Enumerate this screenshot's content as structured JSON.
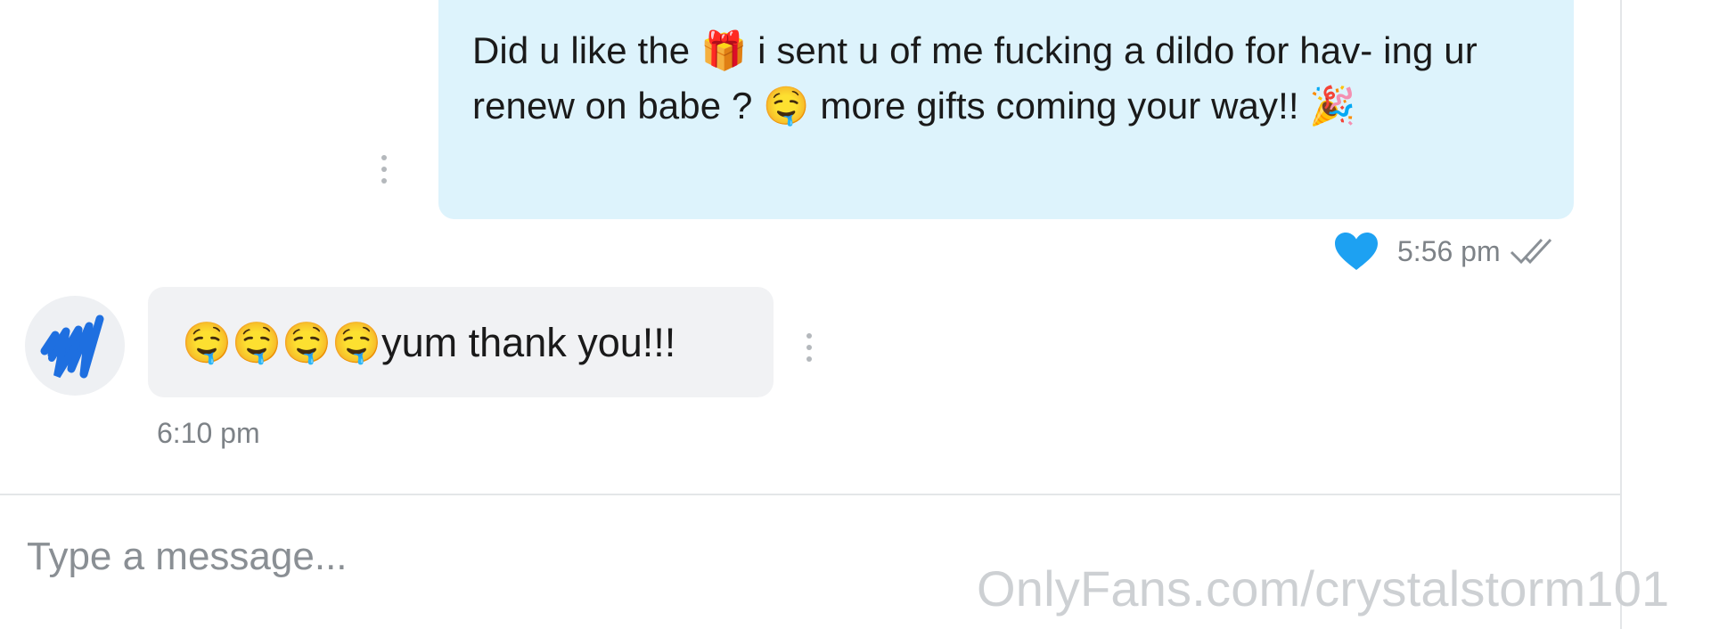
{
  "outgoing_message": {
    "text": "Did u like the 🎁 i sent u of me fucking a dildo for hav- ing ur renew on babe ? 🤤 more gifts coming your way!! 🎉",
    "time": "5:56 pm",
    "liked": true,
    "read_status_icon": "double-check-icon",
    "like_color": "#1da1f2"
  },
  "incoming_message": {
    "text": "🤤🤤🤤🤤yum thank you!!!",
    "time": "6:10 pm",
    "avatar_icon": "scribbled-avatar",
    "avatar_color": "#1e6fe0"
  },
  "composer": {
    "placeholder": "Type a message..."
  },
  "watermark": "OnlyFans.com/crystalstorm101",
  "colors": {
    "outgoing_bubble": "#ddf3fc",
    "incoming_bubble": "#f1f2f4",
    "meta_text": "#7d8287"
  }
}
